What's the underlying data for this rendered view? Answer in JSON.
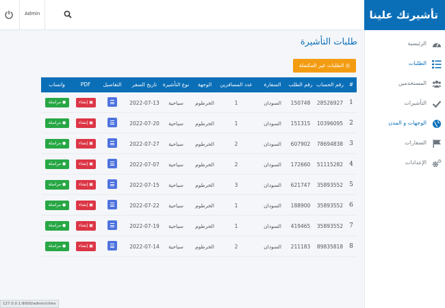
{
  "brand": "تأشيرتك علينا",
  "topbar": {
    "admin_label": "Admin"
  },
  "sidebar": {
    "items": [
      {
        "label": "الرئيسية",
        "icon": "dashboard-icon",
        "active": false
      },
      {
        "label": "الطلبات",
        "icon": "list-icon",
        "active": true
      },
      {
        "label": "المستخدمين",
        "icon": "users-icon",
        "active": false
      },
      {
        "label": "التأشيرات",
        "icon": "check-icon",
        "active": false
      },
      {
        "label": "الوجهات و المدن",
        "icon": "globe-icon",
        "active": true
      },
      {
        "label": "السفارات",
        "icon": "flag-icon",
        "active": false
      },
      {
        "label": "الإعدادات",
        "icon": "gears-icon",
        "active": false
      }
    ]
  },
  "main": {
    "title": "طلبات التأشيرة",
    "incomplete_button": "الطلبات غير المكتملة"
  },
  "table": {
    "headers": {
      "index": "#",
      "account": "رقم الحساب",
      "request": "رقم الطلب",
      "embassy": "السفارة",
      "travelers": "عدد المسافرين",
      "destination": "الوجهة",
      "visa_type": "نوع التأشيرة",
      "travel_date": "تاريخ السفر",
      "details": "التفاصيل",
      "pdf": "PDF",
      "whatsapp": "واتساب"
    },
    "pdf_button": "إنشاء",
    "msg_button": "مراسلة",
    "rows": [
      {
        "index": "1",
        "account": "28526927",
        "request": "150748",
        "embassy": "السودان",
        "travelers": "1",
        "destination": "الخرطوم",
        "visa_type": "سياحية",
        "travel_date": "2022-07-13"
      },
      {
        "index": "2",
        "account": "10396095",
        "request": "151315",
        "embassy": "السودان",
        "travelers": "1",
        "destination": "الخرطوم",
        "visa_type": "سياحية",
        "travel_date": "2022-07-20"
      },
      {
        "index": "3",
        "account": "78694838",
        "request": "607902",
        "embassy": "السودان",
        "travelers": "2",
        "destination": "الخرطوم",
        "visa_type": "سياحية",
        "travel_date": "2022-07-27"
      },
      {
        "index": "4",
        "account": "51115282",
        "request": "172660",
        "embassy": "السودان",
        "travelers": "2",
        "destination": "الخرطوم",
        "visa_type": "سياحية",
        "travel_date": "2022-07-07"
      },
      {
        "index": "5",
        "account": "35893552",
        "request": "621747",
        "embassy": "السودان",
        "travelers": "3",
        "destination": "الخرطوم",
        "visa_type": "سياحية",
        "travel_date": "2022-07-15"
      },
      {
        "index": "6",
        "account": "35893552",
        "request": "188900",
        "embassy": "السودان",
        "travelers": "1",
        "destination": "الخرطوم",
        "visa_type": "سياحية",
        "travel_date": "2022-07-22"
      },
      {
        "index": "7",
        "account": "35893552",
        "request": "419465",
        "embassy": "السودان",
        "travelers": "1",
        "destination": "الخرطوم",
        "visa_type": "سياحية",
        "travel_date": "2022-07-19"
      },
      {
        "index": "8",
        "account": "89835818",
        "request": "211183",
        "embassy": "السودان",
        "travelers": "2",
        "destination": "الخرطوم",
        "visa_type": "سياحية",
        "travel_date": "2022-07-14"
      }
    ]
  },
  "status_url": "127.0.0.1:8000/admin/cities",
  "colors": {
    "primary": "#0b6fb8",
    "warning": "#f39c12",
    "danger": "#dc3545",
    "success": "#28a745",
    "info": "#4e73df"
  }
}
